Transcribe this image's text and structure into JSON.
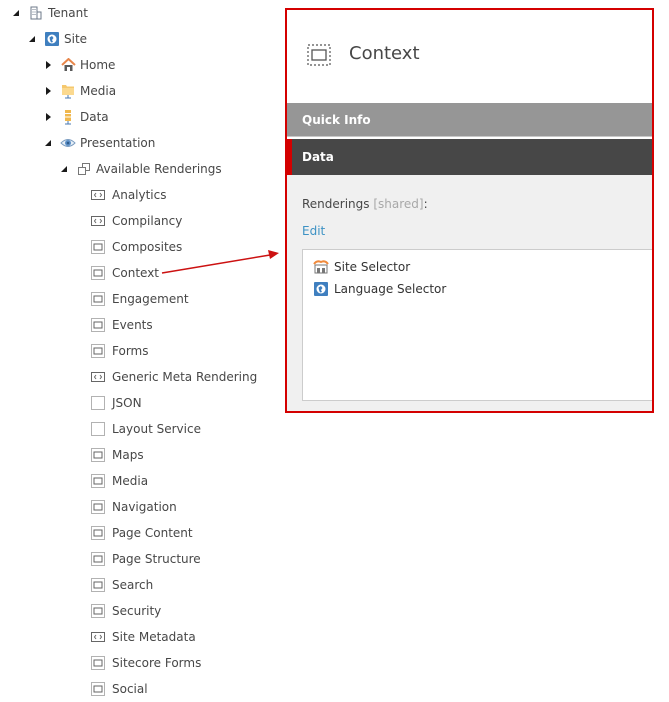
{
  "tree": {
    "tenant": {
      "label": "Tenant",
      "icon": "building-icon",
      "state": "expanded"
    },
    "site": {
      "label": "Site",
      "icon": "globe-icon",
      "state": "expanded"
    },
    "home": {
      "label": "Home",
      "icon": "home-icon",
      "state": "collapsed"
    },
    "media": {
      "label": "Media",
      "icon": "media-folder-icon",
      "state": "collapsed"
    },
    "data": {
      "label": "Data",
      "icon": "data-folder-icon",
      "state": "collapsed"
    },
    "presentation": {
      "label": "Presentation",
      "icon": "eye-icon",
      "state": "expanded"
    },
    "available_renderings": {
      "label": "Available Renderings",
      "icon": "renderings-icon",
      "state": "expanded"
    },
    "renderings": [
      {
        "label": "Analytics",
        "icon": "code-rendering-icon"
      },
      {
        "label": "Compilancy",
        "icon": "code-rendering-icon"
      },
      {
        "label": "Composites",
        "icon": "rendering-icon"
      },
      {
        "label": "Context",
        "icon": "rendering-icon"
      },
      {
        "label": "Engagement",
        "icon": "rendering-icon"
      },
      {
        "label": "Events",
        "icon": "rendering-icon"
      },
      {
        "label": "Forms",
        "icon": "rendering-icon"
      },
      {
        "label": "Generic Meta Rendering",
        "icon": "code-rendering-icon"
      },
      {
        "label": "JSON",
        "icon": "empty-rendering-icon"
      },
      {
        "label": "Layout Service",
        "icon": "empty-rendering-icon"
      },
      {
        "label": "Maps",
        "icon": "rendering-icon"
      },
      {
        "label": "Media",
        "icon": "rendering-icon"
      },
      {
        "label": "Navigation",
        "icon": "rendering-icon"
      },
      {
        "label": "Page Content",
        "icon": "rendering-icon"
      },
      {
        "label": "Page Structure",
        "icon": "rendering-icon"
      },
      {
        "label": "Search",
        "icon": "rendering-icon"
      },
      {
        "label": "Security",
        "icon": "rendering-icon"
      },
      {
        "label": "Site Metadata",
        "icon": "code-rendering-icon"
      },
      {
        "label": "Sitecore Forms",
        "icon": "rendering-icon"
      },
      {
        "label": "Social",
        "icon": "rendering-icon"
      }
    ]
  },
  "panel": {
    "title": "Context",
    "title_icon": "rendering-icon",
    "sections": {
      "quick_info": "Quick Info",
      "data": "Data"
    },
    "field": {
      "label": "Renderings",
      "shared": "[shared]",
      "colon": ":",
      "edit": "Edit",
      "items": [
        {
          "label": "Site Selector",
          "icon": "site-selector-icon"
        },
        {
          "label": "Language Selector",
          "icon": "globe-icon"
        }
      ]
    }
  },
  "colors": {
    "highlight": "#d40000",
    "link": "#3d92c4",
    "quick_info_bg": "#969696",
    "data_bg": "#474747"
  }
}
